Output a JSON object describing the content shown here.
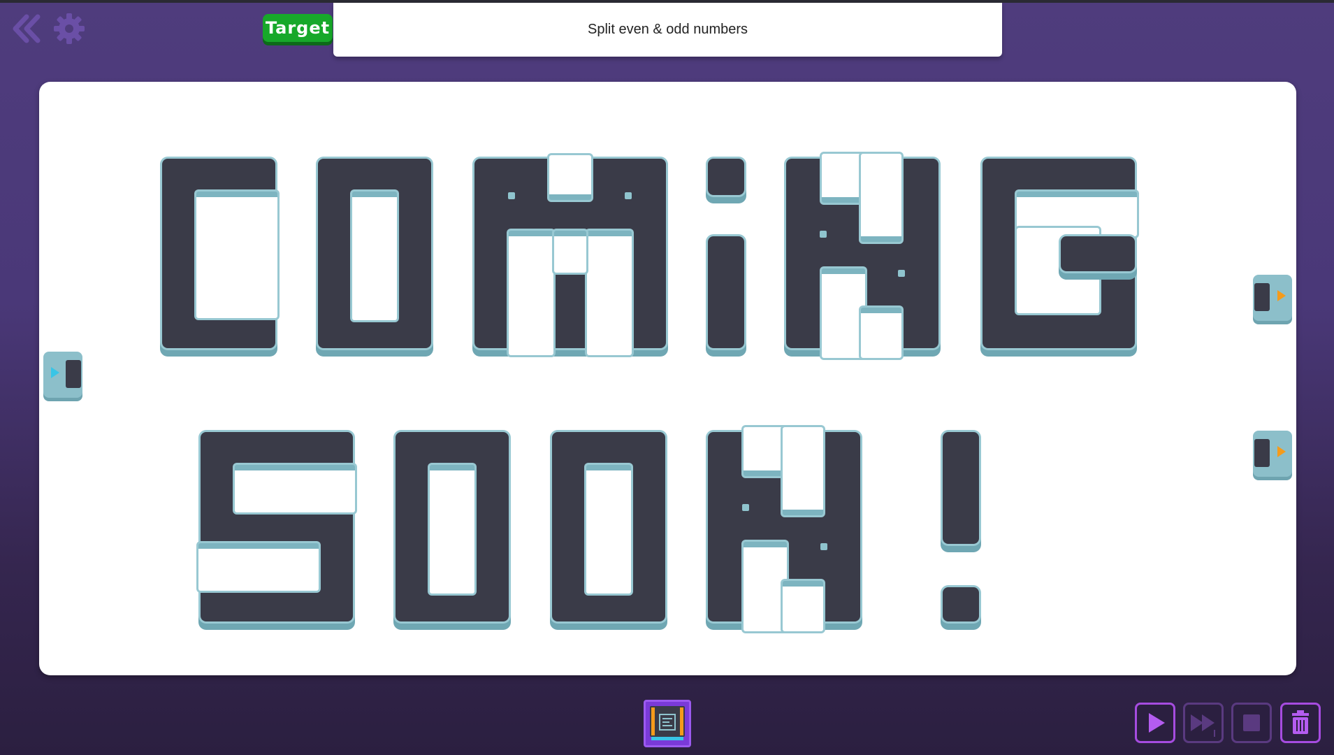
{
  "header": {
    "target_label": "Target",
    "task_text": "Split even & odd numbers"
  },
  "board": {
    "message": [
      "COMiNG",
      "SOON!"
    ]
  },
  "toolbar": {
    "buttons": [
      "play-icon",
      "fast-forward-icon",
      "stop-icon",
      "trash-icon"
    ]
  },
  "colors": {
    "background": "#4a3878",
    "tile": "#3a3b48",
    "tile_edge": "#98c8d2",
    "target_green": "#17a82a",
    "control_purple": "#a64ce0",
    "input_arrow": "#39c5e6",
    "output_arrow": "#f59b1b"
  }
}
